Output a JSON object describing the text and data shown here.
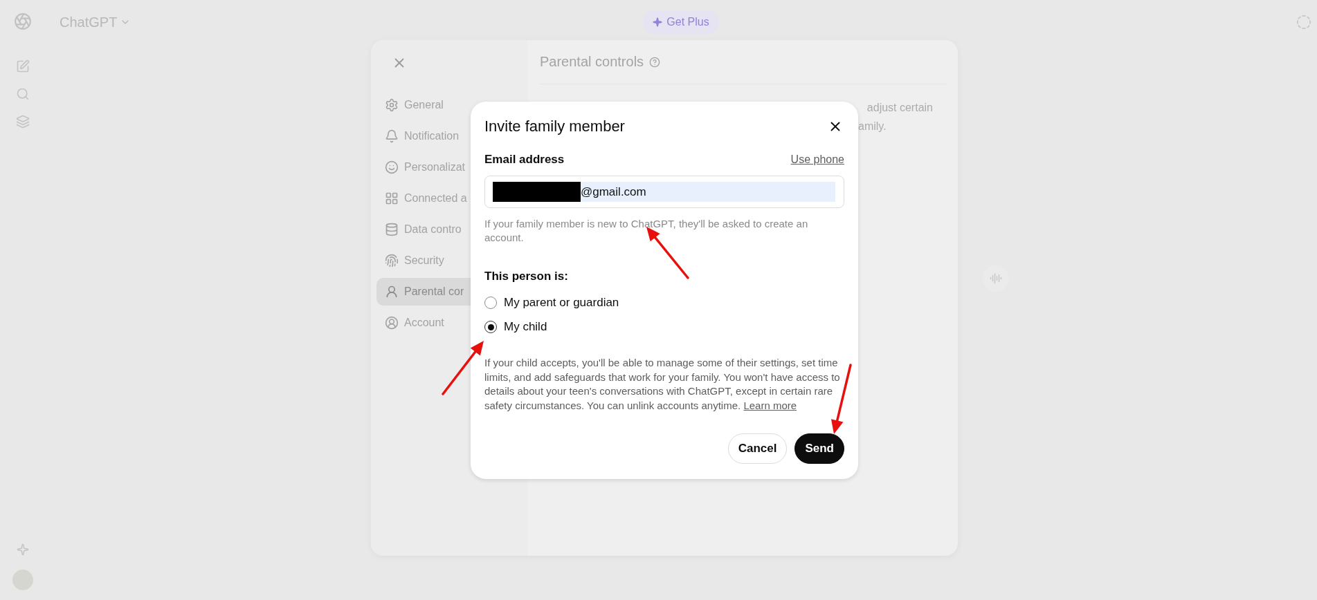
{
  "app": {
    "title": "ChatGPT",
    "upgrade_label": "Get Plus"
  },
  "settings": {
    "nav": [
      {
        "label": "General",
        "selected": false
      },
      {
        "label": "Notification",
        "selected": false
      },
      {
        "label": "Personalizat",
        "selected": false
      },
      {
        "label": "Connected a",
        "selected": false
      },
      {
        "label": "Data contro",
        "selected": false
      },
      {
        "label": "Security",
        "selected": false
      },
      {
        "label": "Parental cor",
        "selected": true
      },
      {
        "label": "Account",
        "selected": false
      }
    ],
    "title": "Parental controls",
    "body_lines": [
      "adjust certain",
      "amily."
    ]
  },
  "dialog": {
    "title": "Invite family member",
    "email": {
      "label": "Email address",
      "switch_link": "Use phone",
      "value": "@gmail.com",
      "redacted": true
    },
    "email_hint": "If your family member is new to ChatGPT, they'll be asked to create an account.",
    "question": "This person is:",
    "options": [
      {
        "label": "My parent or guardian",
        "selected": false
      },
      {
        "label": "My child",
        "selected": true
      }
    ],
    "description": "If your child accepts, you'll be able to manage some of their settings, set time limits, and add safeguards that work for your family. You won't have access to details about your teen's conversations with ChatGPT, except in certain rare safety circumstances. You can unlink accounts anytime.",
    "learn_more": "Learn more",
    "buttons": [
      {
        "label": "Cancel",
        "kind": "secondary"
      },
      {
        "label": "Send",
        "kind": "primary"
      }
    ]
  }
}
